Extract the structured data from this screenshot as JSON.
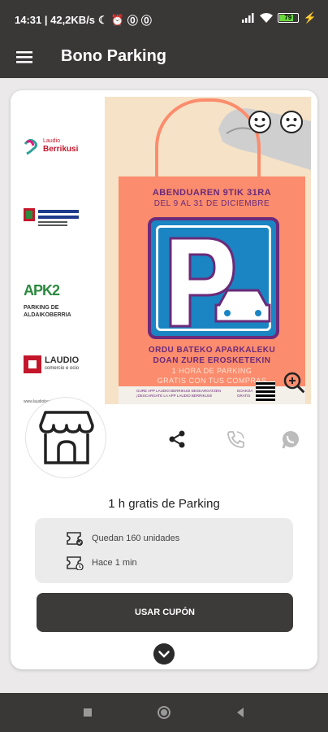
{
  "status_bar": {
    "time_speed": "14:31 | 42,2KB/s",
    "battery": "79"
  },
  "app_bar": {
    "title": "Bono Parking"
  },
  "banner": {
    "logos": [
      {
        "name": "Berrikusi",
        "small": "Laudio"
      },
      {
        "name": "Eusko Jaurlaritza",
        "small": ""
      },
      {
        "name": "APK2",
        "small": "PARKING DE ALDAIKOBERRIA"
      },
      {
        "name": "LAUDIO",
        "small": "comercio e ocio"
      }
    ],
    "website": "www.laudioberrikusi.com",
    "poster_lines": {
      "line1": "ABENDUAREN 9TIK 31RA",
      "line2": "DEL 9 AL 31 DE DICIEMBRE",
      "line3": "ORDU BATEKO APARKALEKU",
      "line4": "DOAN ZURE EROSKETEKIN",
      "line5": "1 HORA DE PARKING",
      "line6": "GRATIS CON TUS COMPRAS",
      "footer": "GURE APP LAUDIO BERRIKUSI DESKARGATZEN\n¡DESCARGATE LA APP LAUDIO BERRIKUSI!",
      "footer_right": "DOAKOA\nGRATIS"
    }
  },
  "coupon": {
    "title": "1 h gratis de Parking",
    "remaining": "Quedan 160 unidades",
    "time_ago": "Hace 1 min",
    "use_button": "USAR CUPÓN"
  },
  "colors": {
    "dark": "#3a3737",
    "accent_orange": "#fb8c6d",
    "parking_blue": "#1a85c2",
    "purple": "#6b2a7a"
  }
}
